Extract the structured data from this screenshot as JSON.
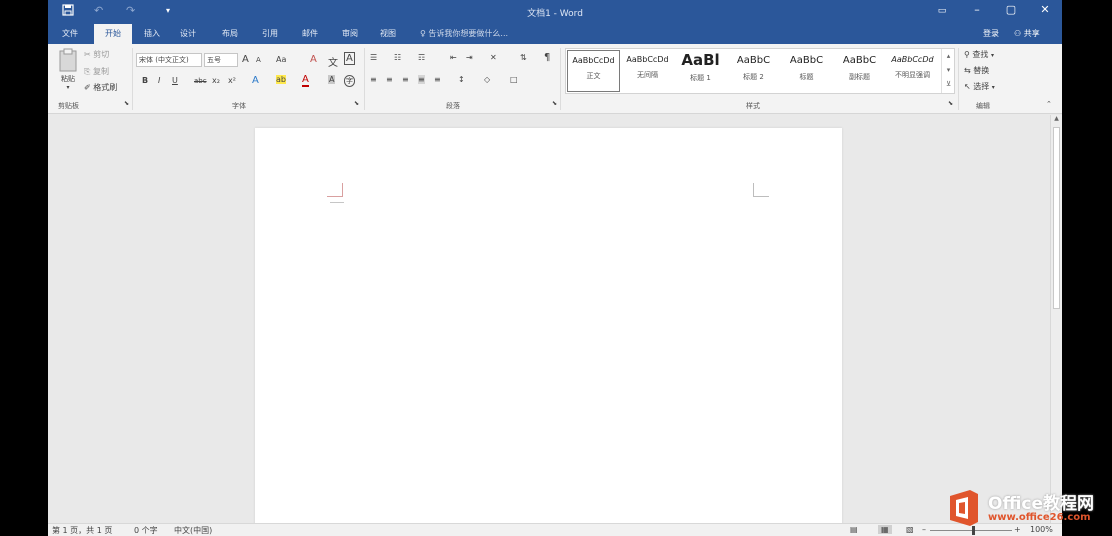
{
  "title_bar": {
    "title": "文档1 - Word",
    "save_icon": "save-icon",
    "undo_icon": "undo-icon",
    "redo_icon": "redo-icon",
    "customize": "▾",
    "window_controls": [
      "restore-ribbon-icon",
      "minimize-icon",
      "maximize-icon",
      "close-icon"
    ],
    "ribbon_display": "▭",
    "minimize": "–",
    "maximize": "▢",
    "close": "✕"
  },
  "tabs": [
    {
      "label": "文件"
    },
    {
      "label": "开始",
      "active": true
    },
    {
      "label": "插入"
    },
    {
      "label": "设计"
    },
    {
      "label": "布局"
    },
    {
      "label": "引用"
    },
    {
      "label": "邮件"
    },
    {
      "label": "审阅"
    },
    {
      "label": "视图"
    }
  ],
  "tell_me": "告诉我你想要做什么...",
  "account": {
    "signin": "登录",
    "share": "共享"
  },
  "ribbon": {
    "clipboard": {
      "paste": "粘贴",
      "cut": "剪切",
      "copy": "复制",
      "format_painter": "格式刷",
      "label": "剪贴板"
    },
    "font": {
      "font_name": "宋体 (中文正文)",
      "font_size": "五号",
      "grow": "A",
      "shrink": "A",
      "case": "Aa",
      "clear": "A",
      "pinyin": "文",
      "border": "A",
      "bold": "B",
      "italic": "I",
      "underline": "U",
      "strike": "abc",
      "subscript": "x₂",
      "superscript": "x²",
      "text_effect": "A",
      "highlight": "ab",
      "font_color": "A",
      "char_shade": "A",
      "enclose": "字",
      "label": "字体"
    },
    "paragraph": {
      "bullets": "☰",
      "numbering": "☷",
      "multilevel": "☶",
      "decrease_indent": "⇤",
      "increase_indent": "⇥",
      "chinese_layout": "✕",
      "sort": "⇅",
      "show_marks": "¶",
      "align_left": "≡",
      "center": "≡",
      "align_right": "≡",
      "justify": "≡",
      "distributed": "≡",
      "line_spacing": "↕",
      "shading": "◇",
      "borders": "□",
      "label": "段落"
    },
    "styles": {
      "items": [
        {
          "sample": "AaBbCcDd",
          "name": "正文",
          "big": false
        },
        {
          "sample": "AaBbCcDd",
          "name": "无间隔",
          "big": false
        },
        {
          "sample": "AaBl",
          "name": "标题 1",
          "big": true
        },
        {
          "sample": "AaBbC",
          "name": "标题 2",
          "big": false
        },
        {
          "sample": "AaBbC",
          "name": "标题",
          "big": false
        },
        {
          "sample": "AaBbC",
          "name": "副标题",
          "big": false
        },
        {
          "sample": "AaBbCcDd",
          "name": "不明显强调",
          "big": false
        }
      ],
      "label": "样式"
    },
    "editing": {
      "find": "查找",
      "replace": "替换",
      "select": "选择",
      "label": "编辑"
    }
  },
  "status_bar": {
    "page": "第 1 页，共 1 页",
    "words": "0 个字",
    "language": "中文(中国)",
    "zoom": "100%"
  },
  "watermark": {
    "brand": "Office教程网",
    "url": "www.office26.com"
  }
}
